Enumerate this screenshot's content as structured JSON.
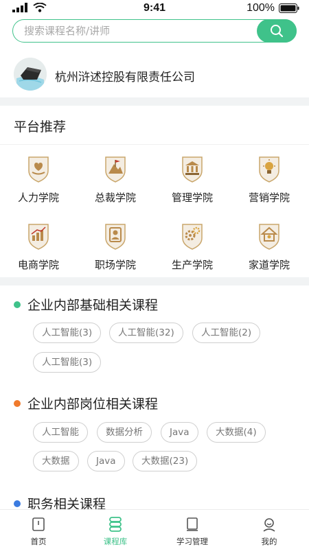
{
  "status_bar": {
    "time": "9:41",
    "battery": "100%"
  },
  "search": {
    "placeholder": "搜索课程名称/讲师"
  },
  "company": {
    "name": "杭州浒述控股有限责任公司"
  },
  "platform": {
    "title": "平台推荐",
    "academies": [
      {
        "label": "人力学院",
        "icon": "hands-heart-badge-icon"
      },
      {
        "label": "总裁学院",
        "icon": "mountain-flag-badge-icon"
      },
      {
        "label": "管理学院",
        "icon": "building-badge-icon"
      },
      {
        "label": "营销学院",
        "icon": "lightbulb-badge-icon"
      },
      {
        "label": "电商学院",
        "icon": "bar-chart-badge-icon"
      },
      {
        "label": "职场学院",
        "icon": "person-card-badge-icon"
      },
      {
        "label": "生产学院",
        "icon": "gears-badge-icon"
      },
      {
        "label": "家道学院",
        "icon": "house-badge-icon"
      }
    ]
  },
  "categories": [
    {
      "title": "企业内部基础相关课程",
      "color": "#3fc28a",
      "tags": [
        "人工智能(3)",
        "人工智能(32)",
        "人工智能(2)",
        "人工智能(3)"
      ]
    },
    {
      "title": "企业内部岗位相关课程",
      "color": "#f07a2c",
      "tags": [
        "人工智能",
        "数据分析",
        "Java",
        "大数据(4)",
        "大数据",
        "Java",
        "大数据(23)"
      ]
    },
    {
      "title": "职务相关课程",
      "color": "#3b7be0",
      "tags": []
    }
  ],
  "tabbar": {
    "items": [
      {
        "label": "首页",
        "icon": "book-home-icon",
        "active": false
      },
      {
        "label": "课程库",
        "icon": "course-library-icon",
        "active": true
      },
      {
        "label": "学习管理",
        "icon": "study-manage-icon",
        "active": false
      },
      {
        "label": "我的",
        "icon": "profile-icon",
        "active": false
      }
    ]
  },
  "colors": {
    "accent": "#3fc28a",
    "divider": "#f1f3f4",
    "badge_gold": "#c9a66b"
  }
}
